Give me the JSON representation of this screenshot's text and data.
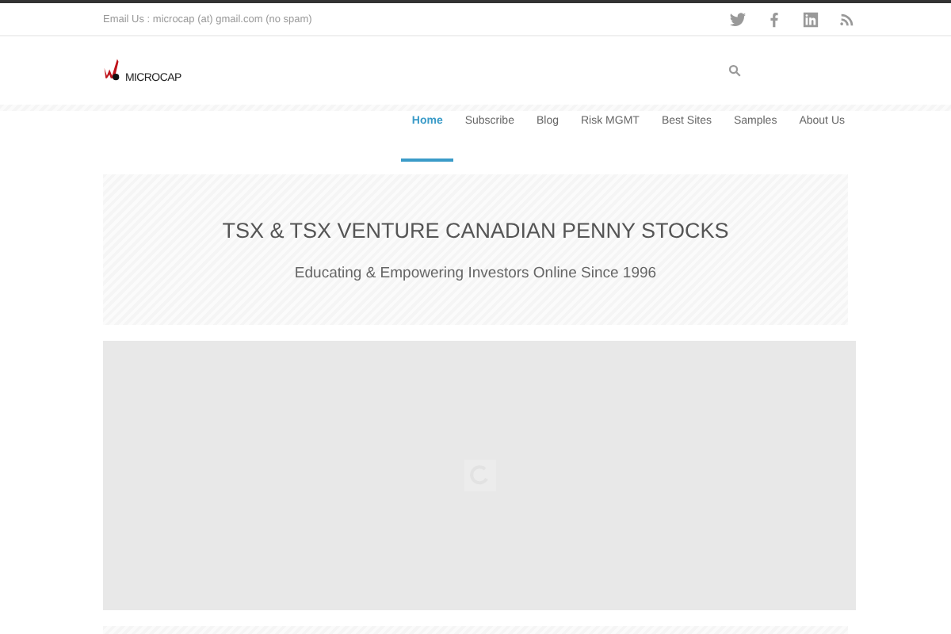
{
  "topbar": {
    "email": "Email Us : microcap (at) gmail.com (no spam)"
  },
  "logo": {
    "text": "MICROCAP"
  },
  "nav": [
    {
      "label": "Home",
      "selected": true
    },
    {
      "label": "Subscribe",
      "selected": false
    },
    {
      "label": "Blog",
      "selected": false
    },
    {
      "label": "Risk MGMT",
      "selected": false
    },
    {
      "label": "Best Sites",
      "selected": false
    },
    {
      "label": "Samples",
      "selected": false
    },
    {
      "label": "About Us",
      "selected": false
    }
  ],
  "hero": {
    "title": "TSX & TSX VENTURE CANADIAN PENNY STOCKS",
    "subtitle": "Educating & Empowering Investors Online Since 1996"
  }
}
